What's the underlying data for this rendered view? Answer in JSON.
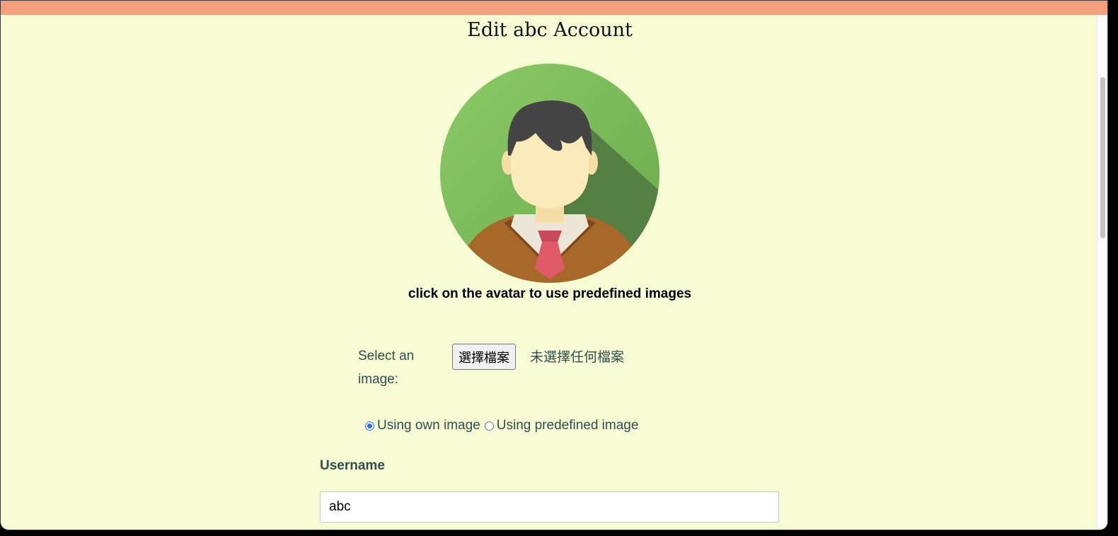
{
  "page": {
    "title": "Edit abc Account",
    "avatar_hint": "click on the avatar to use predefined images"
  },
  "upload": {
    "label": "Select an image:",
    "button_label": "選擇檔案",
    "status": "未選擇任何檔案"
  },
  "image_source": {
    "options": [
      {
        "label": "Using own image",
        "checked": true
      },
      {
        "label": "Using predefined image",
        "checked": false
      }
    ]
  },
  "username": {
    "label": "Username",
    "value": "abc"
  },
  "colors": {
    "top_bar": "#f4a07c",
    "background": "#f7fcd5",
    "text": "#2f4f4f",
    "radio_accent": "#2f6fe4"
  },
  "icons": {
    "avatar": "user-avatar-icon"
  }
}
